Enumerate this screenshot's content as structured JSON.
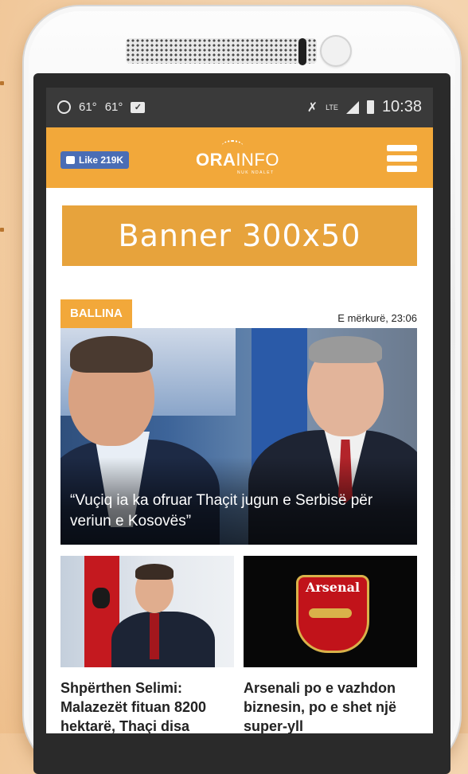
{
  "status_bar": {
    "temp1": "61°",
    "temp2": "61°",
    "network": "LTE",
    "time": "10:38"
  },
  "header": {
    "like_label": "Like 219K",
    "logo_main": "ORA",
    "logo_accent": "INFO",
    "logo_sub": "NUK NDALET"
  },
  "banner": {
    "text": "Banner 300x50"
  },
  "section": {
    "tag": "BALLINA",
    "date": "E mërkurë, 23:06"
  },
  "hero": {
    "caption": "“Vuçiq ia ka ofruar Thaçit jugun e Serbisë për veriun e Kosovës”"
  },
  "cards": [
    {
      "title": "Shpërthen Selimi: Malazezët fituan 8200 hektarë, Thaçi disa"
    },
    {
      "title": "Arsenali po e vazhdon biznesin, po e shet një super-yll",
      "badge": "Arsenal"
    }
  ]
}
